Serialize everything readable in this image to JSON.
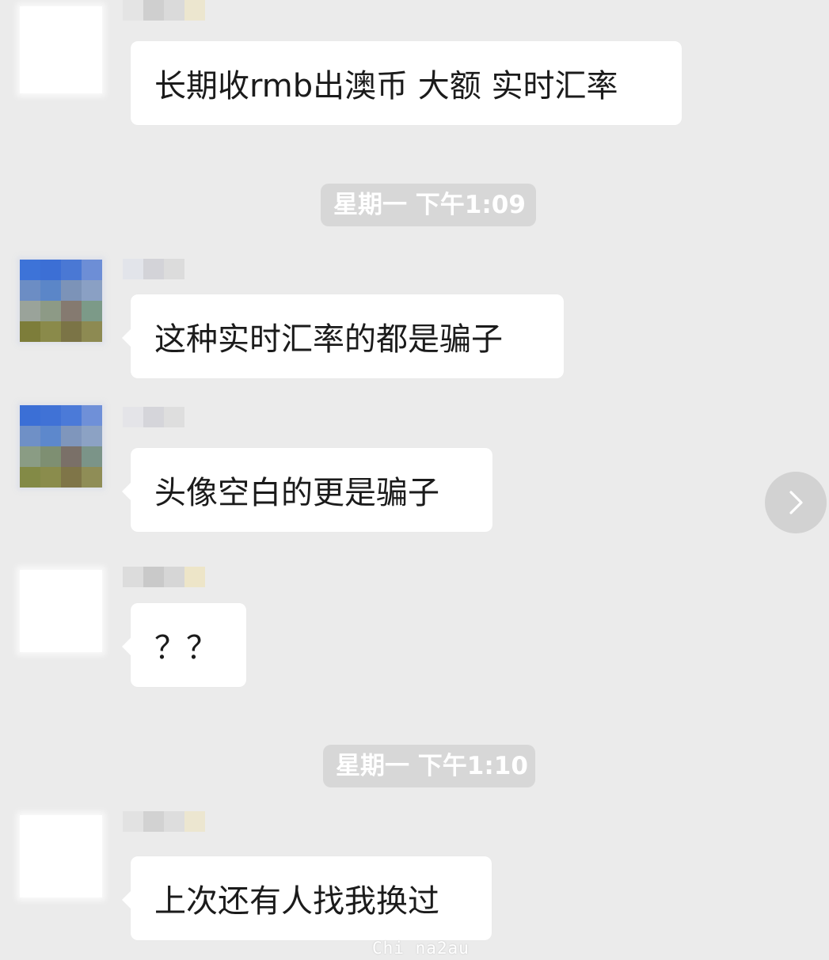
{
  "chat": {
    "messages": [
      {
        "text": "长期收rmb出澳币 大额 实时汇率"
      },
      {
        "text": "这种实时汇率的都是骗子"
      },
      {
        "text": "头像空白的更是骗子"
      },
      {
        "text": "？？"
      },
      {
        "text": "上次还有人找我换过"
      }
    ],
    "timestamps": [
      "星期一 下午1:09",
      "星期一 下午1:10"
    ]
  },
  "icons": {
    "side_arrow": "chevron-right-icon"
  },
  "watermark": {
    "text": "Chi na2au"
  },
  "colors": {
    "background": "#ebebeb",
    "bubble": "#ffffff",
    "timestamp_bg": "#d7d7d7",
    "text": "#1b1b1b"
  }
}
